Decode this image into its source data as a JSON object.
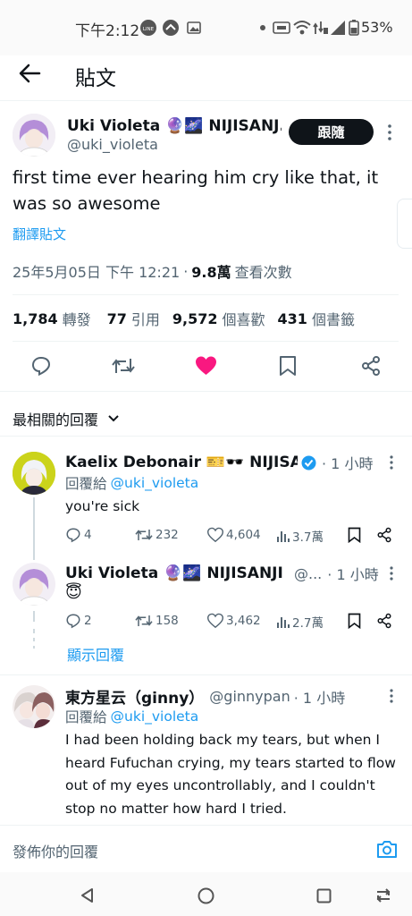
{
  "status_bar": {
    "time": "下午2:12",
    "battery": "53%",
    "line_badge": "LINE"
  },
  "header": {
    "title": "貼文"
  },
  "post": {
    "author_name": "Uki Violeta 🔮🌌 NIJISANJ...",
    "author_handle": "@uki_violeta",
    "follow_label": "跟隨",
    "text": "first time ever hearing him cry like that, it was so awesome",
    "translate_label": "翻譯貼文",
    "timestamp": "25年5月05日 下午 12:21",
    "views_count": "9.8萬",
    "views_label": "查看次數",
    "reposts_count": "1,784",
    "reposts_label": "轉發",
    "quotes_count": "77",
    "quotes_label": "引用",
    "likes_count": "9,572",
    "likes_label": "個喜歡",
    "bookmarks_count": "431",
    "bookmarks_label": "個書籤"
  },
  "sort": {
    "label": "最相關的回覆"
  },
  "replies": [
    {
      "name": "Kaelix Debonair 🎫🕶️ NIJISA...",
      "time": "· 1 小時",
      "reply_to_prefix": "回覆給",
      "reply_to_handle": "@uki_violeta",
      "text": "you're sick",
      "replies": "4",
      "reposts": "232",
      "likes": "4,604",
      "views": "3.7萬"
    },
    {
      "name": "Uki Violeta 🔮🌌 NIJISANJI EN",
      "handle": "@...",
      "time": "· 1 小時",
      "text": "😇",
      "replies": "2",
      "reposts": "158",
      "likes": "3,462",
      "views": "2.7萬",
      "show_replies": "顯示回覆"
    },
    {
      "name": "東方星云（ginny）",
      "handle": "@ginnypan",
      "time": "· 1 小時",
      "reply_to_prefix": "回覆給",
      "reply_to_handle": "@uki_violeta",
      "text": "I had been holding back my tears, but when I heard Fufuchan crying, my tears started to flow out of my eyes uncontrollably, and I couldn't stop no matter how hard I tried."
    }
  ],
  "composer": {
    "placeholder": "發佈你的回覆"
  },
  "colors": {
    "like_active": "#f91880",
    "link": "#1d9bf0",
    "follow_button": "#0f1419"
  }
}
